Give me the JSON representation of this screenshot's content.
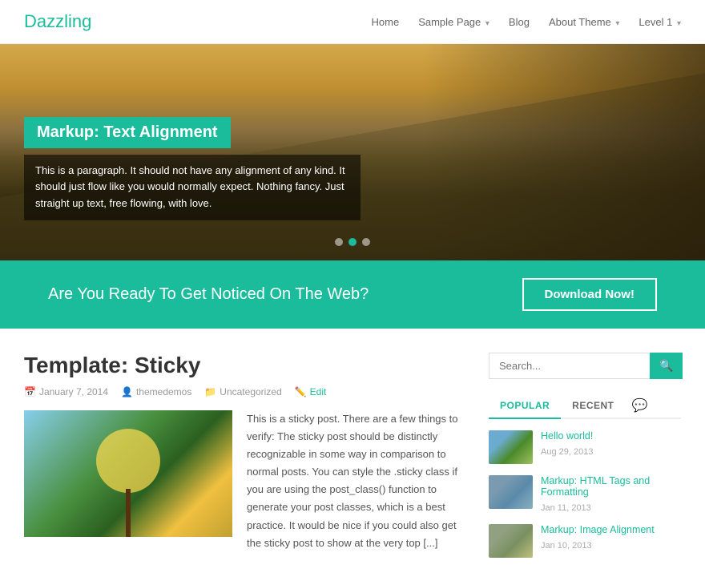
{
  "site": {
    "logo": "Dazzling"
  },
  "nav": {
    "items": [
      {
        "label": "Home",
        "has_dropdown": false
      },
      {
        "label": "Sample Page",
        "has_dropdown": true
      },
      {
        "label": "Blog",
        "has_dropdown": false
      },
      {
        "label": "About Theme",
        "has_dropdown": true
      },
      {
        "label": "Level 1",
        "has_dropdown": true
      }
    ]
  },
  "hero": {
    "slide_title": "Markup: Text Alignment",
    "slide_text": "This is a paragraph. It should not have any alignment of any kind. It should just flow like you would normally expect. Nothing fancy. Just straight up text, free flowing, with love.",
    "dots": [
      {
        "active": false
      },
      {
        "active": true
      },
      {
        "active": false
      }
    ]
  },
  "cta": {
    "text": "Are You Ready To Get Noticed On The Web?",
    "button_label": "Download Now!"
  },
  "post": {
    "title": "Template: Sticky",
    "date": "January 7, 2014",
    "author": "themedemos",
    "category": "Uncategorized",
    "edit_label": "Edit",
    "excerpt": "This is a sticky post. There are a few things to verify: The sticky post should be distinctly recognizable in some way in comparison to normal posts. You can style the .sticky class if you are using the post_class() function to generate your post classes, which is a best practice. It would be nice if you could also get the sticky post to show at the very top [...]"
  },
  "sidebar": {
    "search_placeholder": "Search...",
    "tabs": [
      {
        "label": "POPULAR",
        "active": true
      },
      {
        "label": "RECENT",
        "active": false
      }
    ],
    "popular_posts": [
      {
        "title": "Hello world!",
        "date": "Aug 29, 2013",
        "thumb_class": "thumb-1"
      },
      {
        "title": "Markup: HTML Tags and Formatting",
        "date": "Jan 11, 2013",
        "thumb_class": "thumb-2"
      },
      {
        "title": "Markup: Image Alignment",
        "date": "Jan 10, 2013",
        "thumb_class": "thumb-3"
      }
    ]
  },
  "colors": {
    "accent": "#1abc9c"
  }
}
